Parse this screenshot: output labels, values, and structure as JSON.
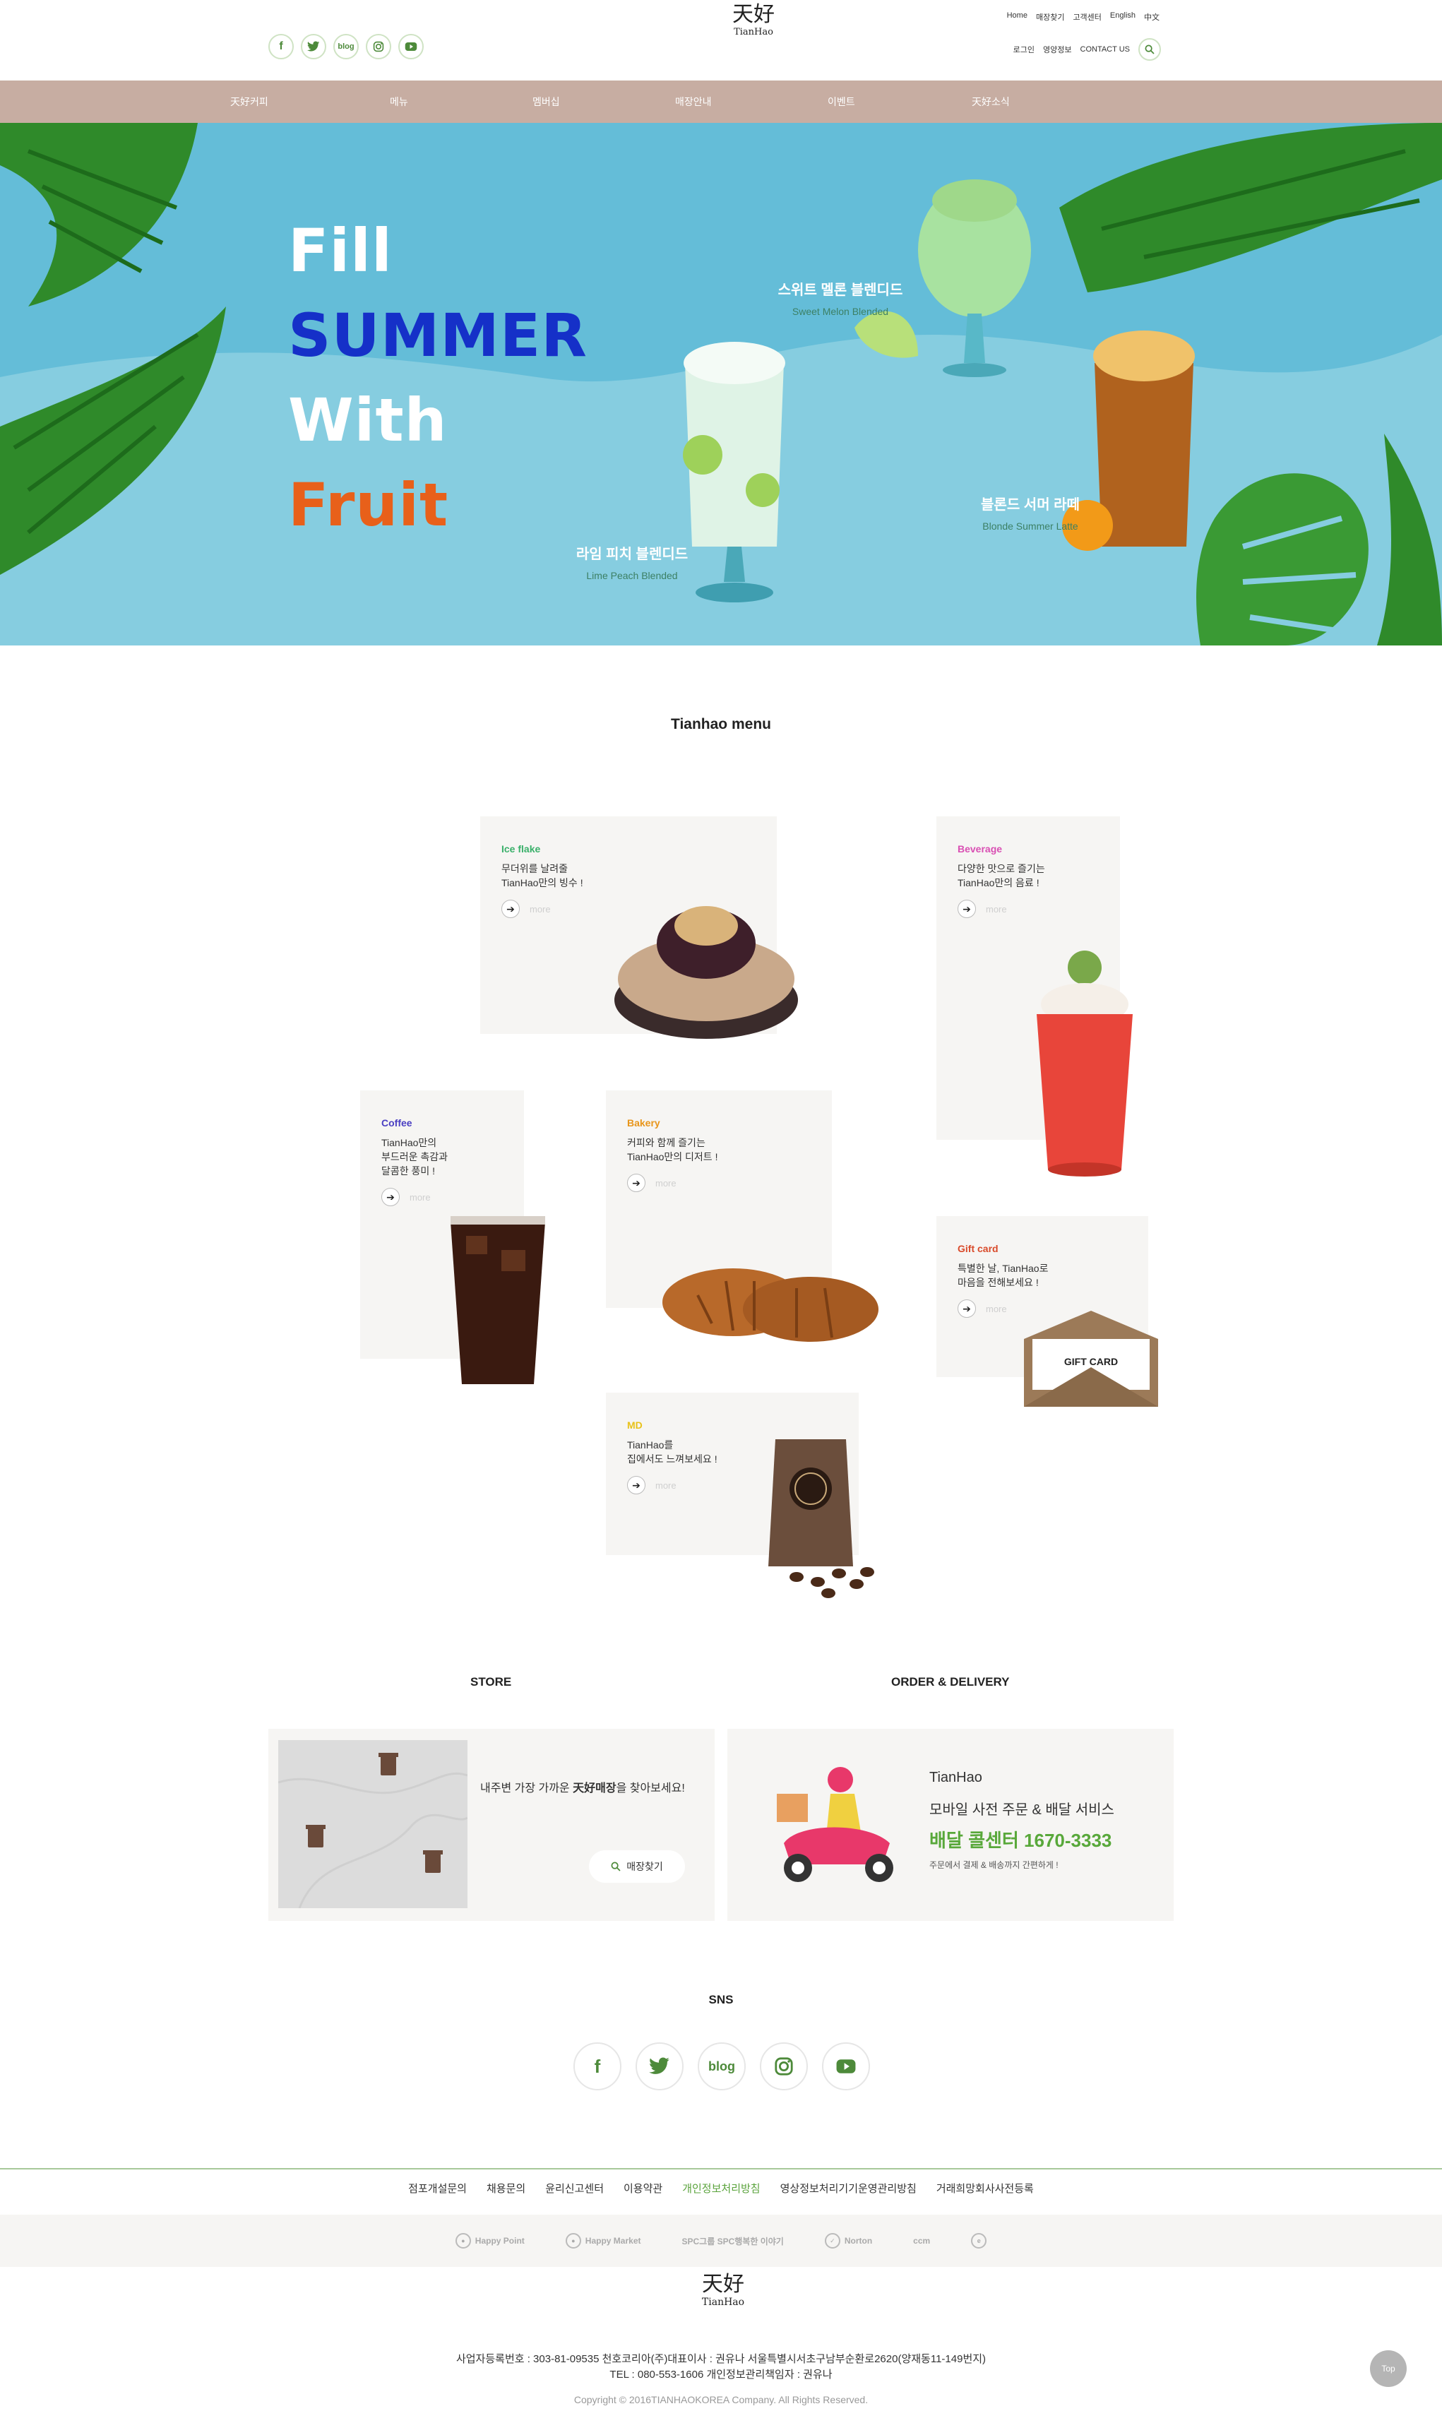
{
  "header": {
    "sns": [
      "f",
      "t",
      "blog",
      "ig",
      "yt"
    ],
    "logo_han": "天好",
    "logo_name": "TianHao",
    "util_top": [
      "Home",
      "매장찾기",
      "고객센터",
      "English",
      "中文"
    ],
    "util_bottom": [
      "로그인",
      "영양정보",
      "CONTACT US"
    ]
  },
  "gnb": [
    "天好커피",
    "메뉴",
    "멤버십",
    "매장안내",
    "이벤트",
    "天好소식"
  ],
  "hero": {
    "line1": "Fill",
    "line2": "SUMMER",
    "line3": "With",
    "line4": "Fruit",
    "colors": {
      "bg": "#64bdd8",
      "line2": "#1530c8",
      "line4": "#e8601a"
    },
    "drinks": [
      {
        "ko": "스위트 멜론 블렌디드",
        "en": "Sweet Melon Blended"
      },
      {
        "ko": "라임 피치 블렌디드",
        "en": "Lime Peach Blended"
      },
      {
        "ko": "블론드 서머 라떼",
        "en": "Blonde Summer Latte"
      }
    ]
  },
  "menu_section": {
    "title": "Tianhao menu",
    "more_label": "more",
    "cards": [
      {
        "cat": "Ice flake",
        "desc": "무더위를 날려줄\nTianHao만의 빙수 !",
        "color": "#3ab06a"
      },
      {
        "cat": "Beverage",
        "desc": "다양한 맛으로 즐기는\nTianHao만의 음료 !",
        "color": "#d94fb3"
      },
      {
        "cat": "Coffee",
        "desc": "TianHao만의\n부드러운 촉감과\n달콤한 풍미 !",
        "color": "#4a3fc2"
      },
      {
        "cat": "Bakery",
        "desc": "커피와 함께 즐기는\nTianHao만의 디저트 !",
        "color": "#e8951a"
      },
      {
        "cat": "Gift card",
        "desc": "특별한 날, TianHao로\n마음을 전해보세요 !",
        "color": "#d94a2a"
      },
      {
        "cat": "MD",
        "desc": "TianHao를\n집에서도 느껴보세요 !",
        "color": "#e8c21a"
      }
    ],
    "gift_card_label": "GIFT CARD"
  },
  "store": {
    "title": "STORE",
    "text_pre": "내주변 가장 가까운 ",
    "text_bold": "天好매장",
    "text_post": "을 찾아보세요!",
    "button": "매장찾기"
  },
  "delivery": {
    "title": "ORDER & DELIVERY",
    "brand": "TianHao",
    "service": "모바일 사전 주문 & 배달 서비스",
    "phone": "배달 콜센터 1670-3333",
    "note": "주문에서 결제 & 배송까지 간편하게 !"
  },
  "sns_section": {
    "title": "SNS",
    "items": [
      "f",
      "t",
      "blog",
      "ig",
      "yt"
    ]
  },
  "footer": {
    "links": [
      "점포개설문의",
      "채용문의",
      "윤리신고센터",
      "이용약관",
      "개인정보처리방침",
      "영상정보처리기기운영관리방침",
      "거래희망회사사전등록"
    ],
    "partners": [
      "Happy Point",
      "Happy Market",
      "SPC그룹 SPC행복한 이야기",
      "Norton",
      "ccm",
      "e"
    ],
    "company_line1": "사업자등록번호 : 303-81-09535 천호코리아(주)대표이사 : 권유나 서울특별시서초구남부순환로2620(양재동11-149번지)",
    "company_line2": "TEL : 080-553-1606 개인정보관리책임자 : 권유나",
    "copyright": "Copyright © 2016TIANHAOKOREA Company. All Rights Reserved.",
    "top_label": "Top"
  }
}
